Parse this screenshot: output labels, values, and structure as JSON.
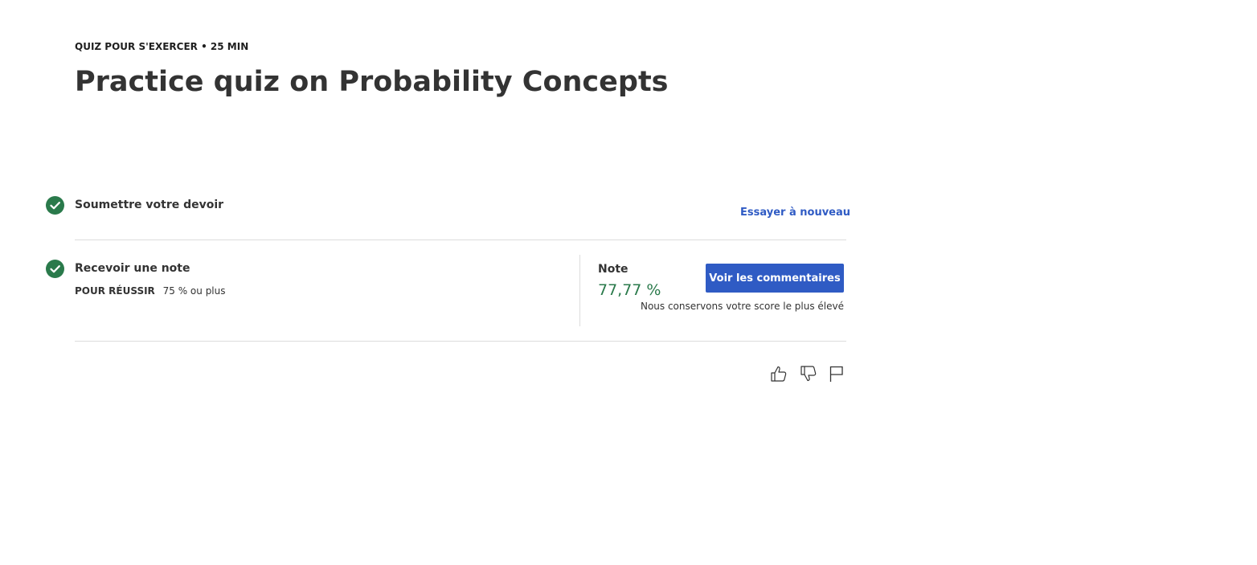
{
  "header": {
    "eyebrow": "QUIZ POUR S'EXERCER • 25 MIN",
    "title": "Practice quiz on Probability Concepts"
  },
  "steps": {
    "submit": {
      "label": "Soumettre votre devoir",
      "action_label": "Essayer à nouveau",
      "status_icon": "check-circle-icon"
    },
    "grade": {
      "label": "Recevoir une note",
      "pass_label": "POUR RÉUSSIR",
      "pass_value": "75 % ou plus",
      "status_icon": "check-circle-icon"
    }
  },
  "grade_panel": {
    "title": "Note",
    "value": "77,77 %",
    "button_label": "Voir les commentaires",
    "note": "Nous conservons votre score le plus élevé"
  },
  "feedback_icons": [
    "thumbs-up-icon",
    "thumbs-down-icon",
    "flag-icon"
  ],
  "colors": {
    "accent": "#2f5bc4",
    "success": "#2a7a4b",
    "text": "#333333",
    "divider": "#dcdcdc"
  }
}
